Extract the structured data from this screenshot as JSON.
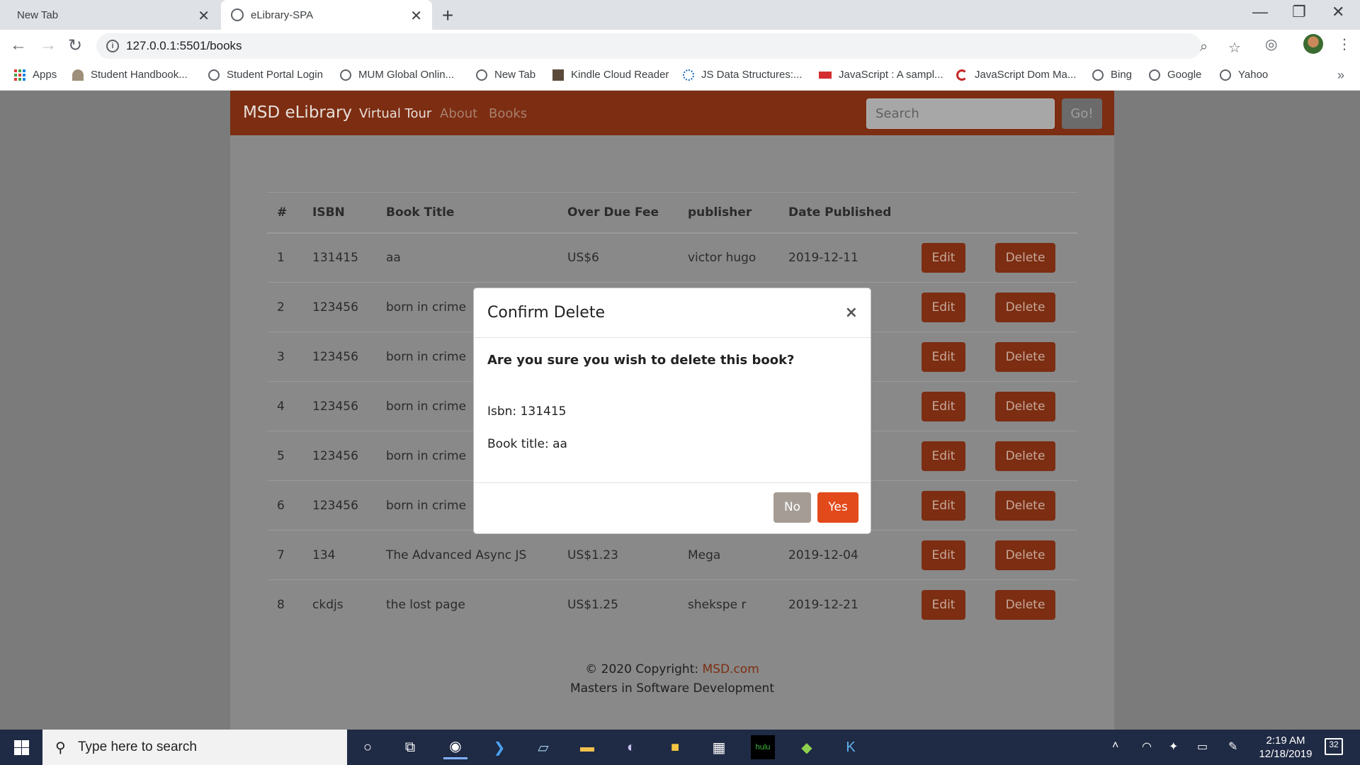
{
  "browser": {
    "tabs": [
      {
        "title": "New Tab"
      },
      {
        "title": "eLibrary-SPA"
      }
    ],
    "url": "127.0.0.1:5501/books",
    "bookmarks": [
      "Apps",
      "Student Handbook...",
      "Student Portal Login",
      "MUM Global Onlin...",
      "New Tab",
      "Kindle Cloud Reader",
      "JS Data Structures:...",
      "JavaScript : A sampl...",
      "JavaScript Dom Ma...",
      "Bing",
      "Google",
      "Yahoo"
    ]
  },
  "navbar": {
    "brand": "MSD eLibrary",
    "links": [
      "Virtual Tour",
      "About",
      "Books"
    ],
    "search_placeholder": "Search",
    "go_label": "Go!"
  },
  "table": {
    "headers": [
      "#",
      "ISBN",
      "Book Title",
      "Over Due Fee",
      "publisher",
      "Date Published"
    ],
    "rows": [
      {
        "num": "1",
        "isbn": "131415",
        "title": "aa",
        "fee": "US$6",
        "publisher": "victor hugo",
        "date": "2019-12-11"
      },
      {
        "num": "2",
        "isbn": "123456",
        "title": "born in crime",
        "fee": "",
        "publisher": "",
        "date": ""
      },
      {
        "num": "3",
        "isbn": "123456",
        "title": "born in crime",
        "fee": "",
        "publisher": "",
        "date": ""
      },
      {
        "num": "4",
        "isbn": "123456",
        "title": "born in crime",
        "fee": "",
        "publisher": "",
        "date": ""
      },
      {
        "num": "5",
        "isbn": "123456",
        "title": "born in crime",
        "fee": "",
        "publisher": "",
        "date": ""
      },
      {
        "num": "6",
        "isbn": "123456",
        "title": "born in crime",
        "fee": "",
        "publisher": "",
        "date": ""
      },
      {
        "num": "7",
        "isbn": "134",
        "title": "The Advanced Async JS",
        "fee": "US$1.23",
        "publisher": "Mega",
        "date": "2019-12-04"
      },
      {
        "num": "8",
        "isbn": "ckdjs",
        "title": "the lost page",
        "fee": "US$1.25",
        "publisher": "shekspe r",
        "date": "2019-12-21"
      }
    ],
    "edit_label": "Edit",
    "delete_label": "Delete"
  },
  "footer": {
    "copyright_prefix": "© 2020 Copyright: ",
    "copyright_link": "MSD.com",
    "tagline": "Masters in Software Development"
  },
  "modal": {
    "title": "Confirm Delete",
    "close": "×",
    "question": "Are you sure you wish to delete this book?",
    "isbn_line": "Isbn: 131415",
    "title_line": "Book title: aa",
    "no_label": "No",
    "yes_label": "Yes"
  },
  "taskbar": {
    "search_placeholder": "Type here to search",
    "time": "2:19 AM",
    "date": "12/18/2019",
    "notifications": "32"
  },
  "colors": {
    "navbar": "#7c2d12",
    "accent": "#e2491b",
    "no_button": "#a59d95"
  }
}
